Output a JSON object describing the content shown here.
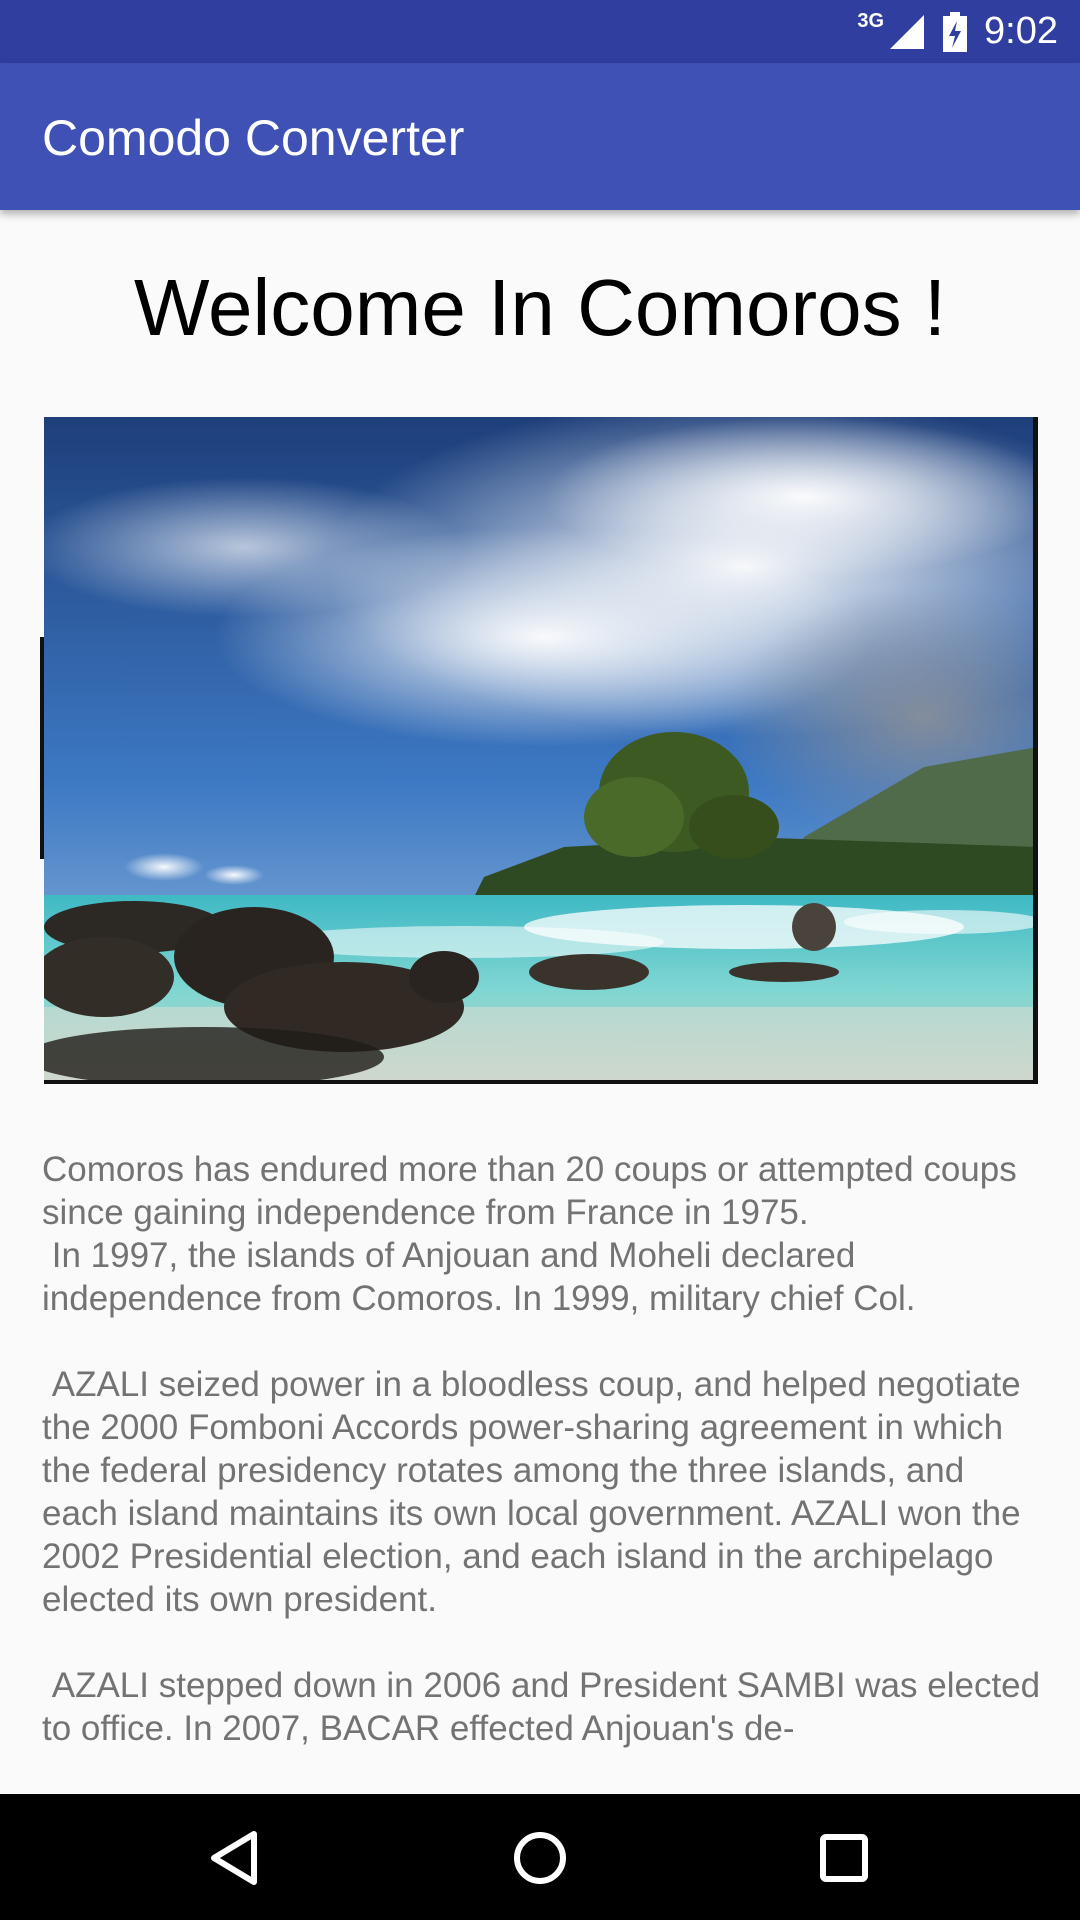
{
  "status_bar": {
    "network": "3G",
    "time": "9:02",
    "icons": [
      "signal-icon",
      "battery-charging-icon"
    ]
  },
  "app_bar": {
    "title": "Comodo Converter",
    "color": "#3f51b5",
    "status_color": "#303f9f"
  },
  "content": {
    "heading": "Welcome In Comoros !",
    "image": "beach-landscape-image",
    "paragraphs": [
      "Comoros has endured more than 20 coups or attempted coups since gaining independence from France in 1975.\n In 1997, the islands of Anjouan and Moheli declared independence from Comoros. In 1999, military chief Col.",
      " AZALI seized power in a bloodless coup, and helped negotiate the 2000 Fomboni Accords power-sharing agreement in which the federal presidency rotates among the three islands, and each island maintains its own local government. AZALI won the 2002 Presidential election, and each island in the archipelago elected its own president.",
      " AZALI stepped down in 2006 and President SAMBI was elected to office. In 2007, BACAR effected Anjouan's de-"
    ]
  },
  "nav_bar": {
    "buttons": [
      "back-icon",
      "home-icon",
      "recents-icon"
    ]
  }
}
